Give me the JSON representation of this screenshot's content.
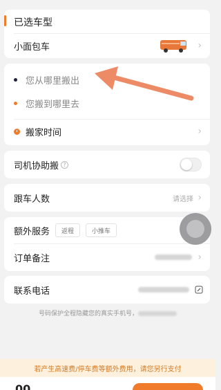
{
  "vehicle_section": {
    "title": "已选车型",
    "vehicle_name": "小面包车",
    "van_text": "货拉拉"
  },
  "route": {
    "pickup_placeholder": "您从哪里搬出",
    "dropoff_placeholder": "您搬到哪里去",
    "time_label": "搬家时间"
  },
  "options": {
    "driver_help_label": "司机协助搬",
    "passenger_label": "跟车人数",
    "passenger_placeholder": "请选择"
  },
  "extras": {
    "label": "额外服务",
    "tags": [
      "返程",
      "小推车"
    ],
    "notes_label": "订单备注"
  },
  "contact": {
    "label": "联系电话",
    "privacy_note_prefix": "号码保护全程隐藏您的真实手机号，"
  },
  "footer": {
    "notice": "若产生高速费/停车费等额外费用，请您另行支付",
    "price_partial": "00"
  },
  "colors": {
    "accent": "#f07c2b",
    "notice_bg": "#fdf1de",
    "notice_text": "#d47a24"
  }
}
